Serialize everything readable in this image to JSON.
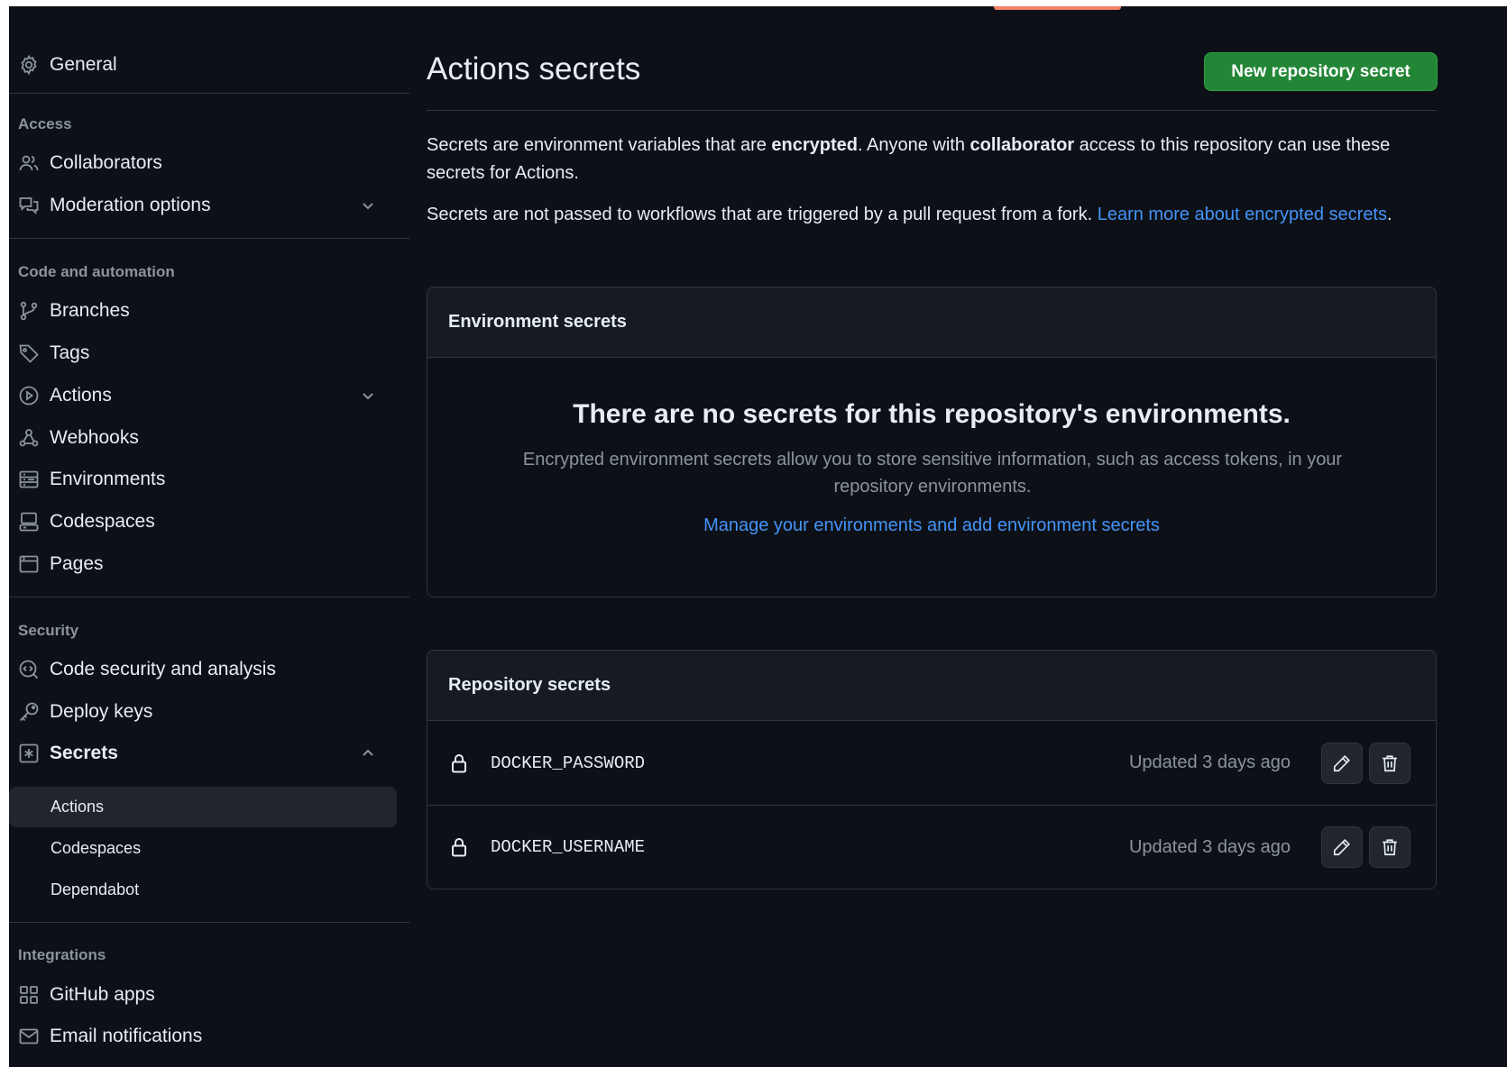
{
  "sidebar": {
    "general": "General",
    "sections": {
      "access": "Access",
      "code_automation": "Code and automation",
      "security": "Security",
      "integrations": "Integrations"
    },
    "items": {
      "collaborators": "Collaborators",
      "moderation": "Moderation options",
      "branches": "Branches",
      "tags": "Tags",
      "actions": "Actions",
      "webhooks": "Webhooks",
      "environments": "Environments",
      "codespaces": "Codespaces",
      "pages": "Pages",
      "code_security": "Code security and analysis",
      "deploy_keys": "Deploy keys",
      "secrets": "Secrets",
      "github_apps": "GitHub apps",
      "email_notifications": "Email notifications"
    },
    "secrets_sub": {
      "actions": "Actions",
      "codespaces": "Codespaces",
      "dependabot": "Dependabot"
    }
  },
  "main": {
    "title": "Actions secrets",
    "new_button": "New repository secret",
    "intro": {
      "p1_a": "Secrets are environment variables that are ",
      "p1_b": "encrypted",
      "p1_c": ". Anyone with ",
      "p1_d": "collaborator",
      "p1_e": " access to this repository can use these secrets for Actions.",
      "p2_a": "Secrets are not passed to workflows that are triggered by a pull request from a fork. ",
      "p2_link": "Learn more about encrypted secrets",
      "p2_end": "."
    },
    "env_box": {
      "header": "Environment secrets",
      "empty_title": "There are no secrets for this repository's environments.",
      "empty_desc": "Encrypted environment secrets allow you to store sensitive information, such as access tokens, in your repository environments.",
      "empty_link": "Manage your environments and add environment secrets"
    },
    "repo_box": {
      "header": "Repository secrets",
      "rows": [
        {
          "name": "DOCKER_PASSWORD",
          "updated": "Updated 3 days ago"
        },
        {
          "name": "DOCKER_USERNAME",
          "updated": "Updated 3 days ago"
        }
      ]
    }
  },
  "colors": {
    "background": "#0d1117",
    "accent_green": "#238636",
    "link_blue": "#4493f8",
    "muted": "#8b949e"
  }
}
